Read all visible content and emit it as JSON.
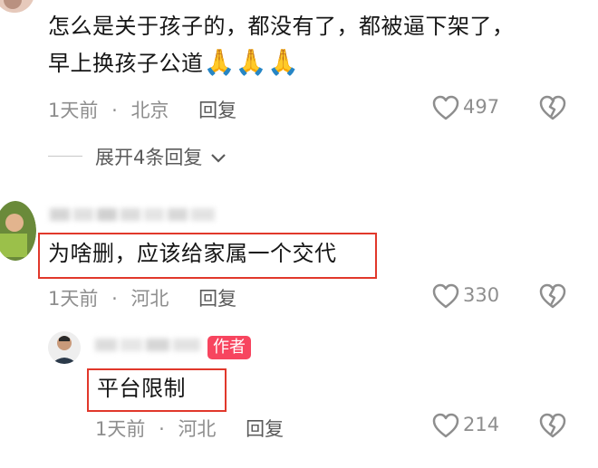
{
  "comment1": {
    "text_line1": "怎么是关于孩子的，都没有了，都被逼下架了，",
    "text_line2": "早上换孩子公道",
    "emoji": [
      "🙏",
      "🙏",
      "🙏"
    ],
    "time": "1天前",
    "sep": "·",
    "location": "北京",
    "reply_label": "回复",
    "likes": "497",
    "expand_label": "展开4条回复"
  },
  "comment2": {
    "text": "为啥删，应该给家属一个交代",
    "time": "1天前",
    "sep": "·",
    "location": "河北",
    "reply_label": "回复",
    "likes": "330"
  },
  "reply1": {
    "author_tag": "作者",
    "text": "平台限制",
    "time": "1天前",
    "sep": "·",
    "location": "河北",
    "reply_label": "回复",
    "likes": "214"
  },
  "colors": {
    "highlight": "#e1382b",
    "author_tag": "#f7455f",
    "meta": "#8e8e8e"
  }
}
